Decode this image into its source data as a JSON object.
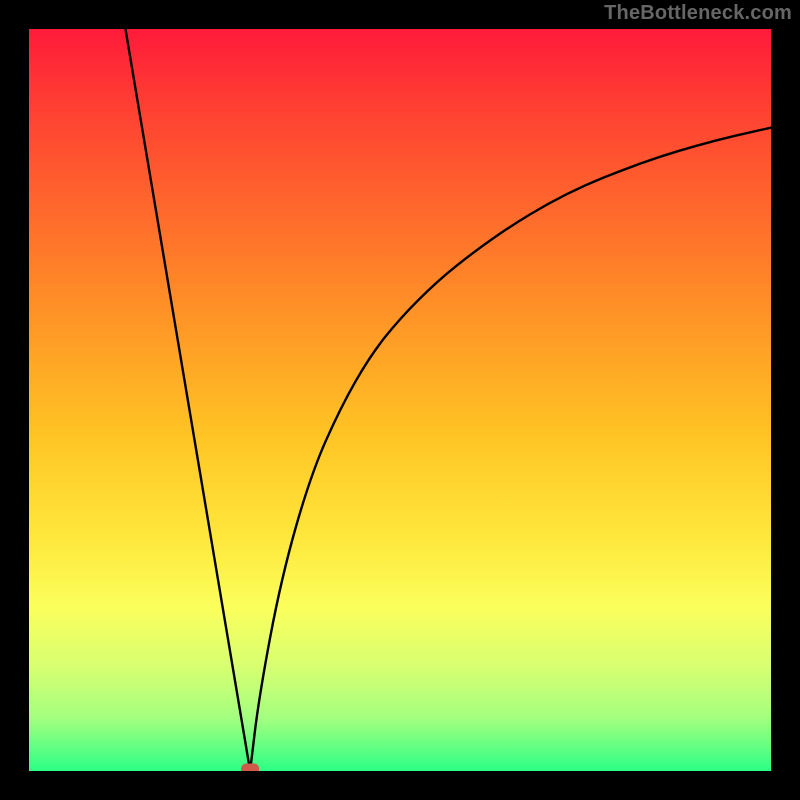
{
  "watermark": "TheBottleneck.com",
  "chart_data": {
    "type": "line",
    "title": "",
    "xlabel": "",
    "ylabel": "",
    "xlim": [
      0,
      100
    ],
    "ylim": [
      0,
      100
    ],
    "grid": false,
    "legend": false,
    "background_gradient": {
      "stops": [
        {
          "offset": 0.0,
          "color": "#ff1a3a"
        },
        {
          "offset": 0.1,
          "color": "#ff3e33"
        },
        {
          "offset": 0.25,
          "color": "#ff6a2c"
        },
        {
          "offset": 0.4,
          "color": "#ff9826"
        },
        {
          "offset": 0.55,
          "color": "#ffc524"
        },
        {
          "offset": 0.68,
          "color": "#ffe63a"
        },
        {
          "offset": 0.78,
          "color": "#fbff5c"
        },
        {
          "offset": 0.86,
          "color": "#d7ff71"
        },
        {
          "offset": 0.93,
          "color": "#a2ff7f"
        },
        {
          "offset": 1.0,
          "color": "#2cff86"
        }
      ]
    },
    "series": [
      {
        "name": "left-branch",
        "x": [
          13,
          15,
          17,
          19,
          21,
          23,
          25,
          27,
          29,
          29.8
        ],
        "y": [
          100,
          88.1,
          76.2,
          64.3,
          52.4,
          40.5,
          28.6,
          16.7,
          4.8,
          0
        ],
        "description": "steep descending near-linear segment"
      },
      {
        "name": "right-branch",
        "x": [
          29.8,
          31,
          34,
          38,
          42,
          46,
          50,
          55,
          60,
          65,
          70,
          75,
          80,
          85,
          90,
          95,
          100
        ],
        "y": [
          0,
          10,
          26,
          40,
          49,
          56,
          61,
          66,
          70,
          73.5,
          76.5,
          79,
          81,
          82.8,
          84.3,
          85.6,
          86.7
        ],
        "description": "rising concave curve that flattens toward the right"
      }
    ],
    "marker": {
      "name": "minimum-point",
      "x": 29.8,
      "y": 0,
      "color": "#d05a4a",
      "shape": "rounded-rect"
    }
  }
}
